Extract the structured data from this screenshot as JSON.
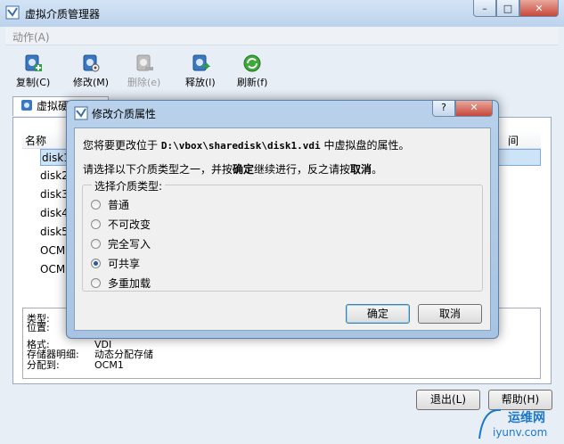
{
  "window": {
    "title": "虚拟介质管理器",
    "minimize": "–",
    "maximize": "□",
    "close": "✕"
  },
  "menubar": {
    "action": "动作(A)"
  },
  "toolbar": {
    "copy": "复制(C)",
    "modify": "修改(M)",
    "delete": "删除(e)",
    "release": "释放(l)",
    "refresh": "刷新(f)"
  },
  "tabs": {
    "disks": "虚拟硬盘"
  },
  "list": {
    "col_name": "名称",
    "col_time": "间",
    "rows": [
      "disk1",
      "disk2",
      "disk3",
      "disk4",
      "disk5",
      "OCM",
      "OCM"
    ]
  },
  "info": {
    "type_label": "类型:",
    "loc_label": "位置:",
    "format_label": "格式:",
    "format_value": "VDI",
    "storage_label": "存储器明细:",
    "storage_value": "动态分配存储",
    "attached_label": "分配到:",
    "attached_value": "OCM1"
  },
  "main_buttons": {
    "exit": "退出(L)",
    "help": "帮助(H)"
  },
  "watermark": {
    "brand": "运维网",
    "url": "iyunv.com"
  },
  "dialog": {
    "title": "修改介质属性",
    "help_btn": "?",
    "close_btn": "✕",
    "line1_pre": "您将要更改位于",
    "line1_path": "D:\\vbox\\sharedisk\\disk1.vdi",
    "line1_post": "中虚拟盘的属性。",
    "line2_a": "请选择以下介质类型之一，并按",
    "line2_b": "确定",
    "line2_c": "继续进行，反之请按",
    "line2_d": "取消",
    "line2_e": "。",
    "group_label": "选择介质类型:",
    "options": [
      "普通",
      "不可改变",
      "完全写入",
      "可共享",
      "多重加载"
    ],
    "selected_index": 3,
    "ok": "确定",
    "cancel": "取消"
  }
}
